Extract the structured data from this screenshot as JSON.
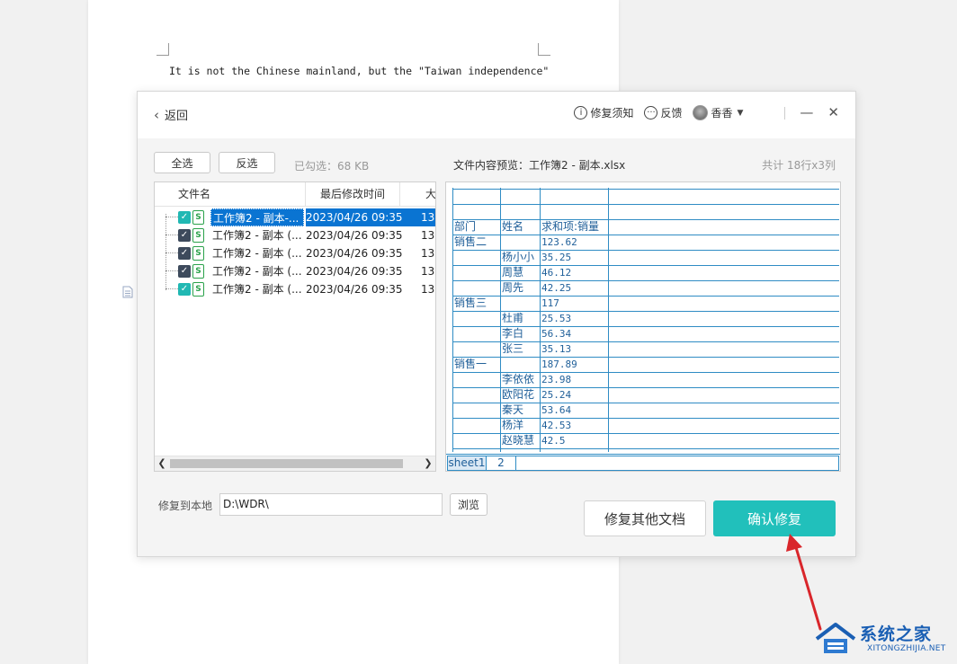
{
  "document": {
    "text": "It is not the Chinese mainland, but the \"Taiwan independence\""
  },
  "header": {
    "back_label": "返回",
    "repair_notice_label": "修复须知",
    "feedback_label": "反馈",
    "user_name": "香香",
    "minimize_glyph": "—",
    "close_glyph": "✕"
  },
  "toolbar": {
    "select_all_label": "全选",
    "invert_label": "反选",
    "selected_info": "已勾选：68 KB"
  },
  "file_list": {
    "columns": [
      "文件名",
      "最后修改时间",
      "大"
    ],
    "rows": [
      {
        "name": "工作簿2 - 副本-...",
        "date": "2023/04/26 09:35",
        "size": "13",
        "checked_style": "teal",
        "selected": true
      },
      {
        "name": "工作簿2 - 副本 (...",
        "date": "2023/04/26 09:35",
        "size": "13",
        "checked_style": "dark",
        "selected": false
      },
      {
        "name": "工作簿2 - 副本 (...",
        "date": "2023/04/26 09:35",
        "size": "13",
        "checked_style": "dark",
        "selected": false
      },
      {
        "name": "工作簿2 - 副本 (...",
        "date": "2023/04/26 09:35",
        "size": "13",
        "checked_style": "dark",
        "selected": false
      },
      {
        "name": "工作簿2 - 副本 (...",
        "date": "2023/04/26 09:35",
        "size": "13",
        "checked_style": "teal",
        "selected": false
      }
    ]
  },
  "preview": {
    "file_label": "文件内容预览：工作簿2 - 副本.xlsx",
    "total_info": "共计 18行x3列",
    "headers": [
      "部门",
      "姓名",
      "求和项:销量"
    ],
    "rows": [
      [
        "销售二",
        "",
        "123.62"
      ],
      [
        "",
        "杨小小",
        "35.25"
      ],
      [
        "",
        "周慧",
        "46.12"
      ],
      [
        "",
        "周先",
        "42.25"
      ],
      [
        "销售三",
        "",
        "117"
      ],
      [
        "",
        "杜甫",
        "25.53"
      ],
      [
        "",
        "李白",
        "56.34"
      ],
      [
        "",
        "张三",
        "35.13"
      ],
      [
        "销售一",
        "",
        "187.89"
      ],
      [
        "",
        "李依依",
        "23.98"
      ],
      [
        "",
        "欧阳花",
        "25.24"
      ],
      [
        "",
        "秦天",
        "53.64"
      ],
      [
        "",
        "杨洋",
        "42.53"
      ],
      [
        "",
        "赵晓慧",
        "42.5"
      ]
    ],
    "sheets": [
      "sheet1",
      "2"
    ]
  },
  "footer": {
    "path_label": "修复到本地",
    "path_value": "D:\\WDR\\",
    "browse_label": "浏览",
    "other_docs_label": "修复其他文档",
    "confirm_label": "确认修复"
  },
  "watermark": {
    "title": "系统之家",
    "subtitle": "XITONGZHIJIA.NET"
  },
  "colors": {
    "accent": "#21c0bb",
    "selection": "#0a74d2",
    "grid": "#2f8cc4",
    "annotation": "#d9262b"
  }
}
